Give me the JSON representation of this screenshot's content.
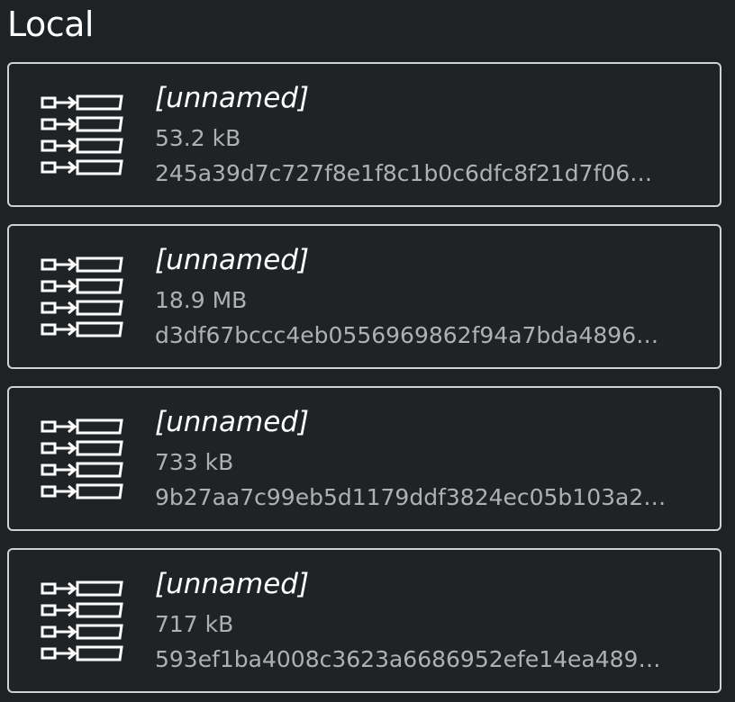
{
  "section": {
    "title": "Local"
  },
  "items": [
    {
      "name": "[unnamed]",
      "size": "53.2 kB",
      "hash": "245a39d7c727f8e1f8c1b0c6dfc8f21d7f06…",
      "icon": "package-list-icon"
    },
    {
      "name": "[unnamed]",
      "size": "18.9 MB",
      "hash": "d3df67bccc4eb0556969862f94a7bda4896…",
      "icon": "package-list-icon"
    },
    {
      "name": "[unnamed]",
      "size": "733 kB",
      "hash": "9b27aa7c99eb5d1179ddf3824ec05b103a2…",
      "icon": "package-list-icon"
    },
    {
      "name": "[unnamed]",
      "size": "717 kB",
      "hash": "593ef1ba4008c3623a6686952efe14ea489…",
      "icon": "package-list-icon"
    }
  ]
}
